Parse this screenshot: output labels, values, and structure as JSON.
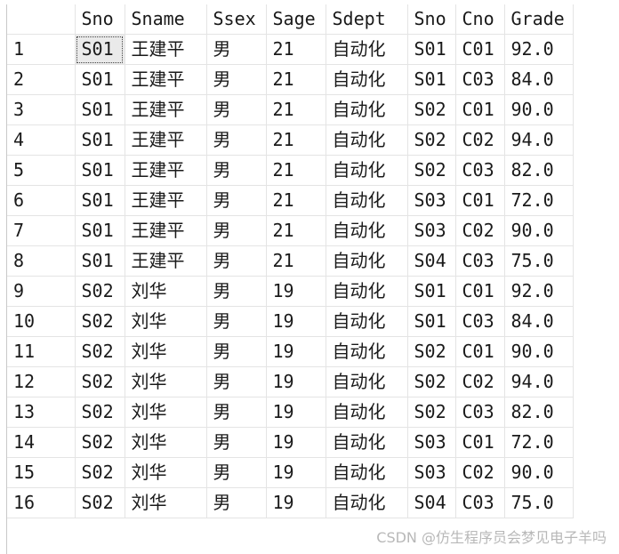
{
  "columns": [
    "Sno",
    "Sname",
    "Ssex",
    "Sage",
    "Sdept",
    "Sno",
    "Cno",
    "Grade"
  ],
  "rows": [
    {
      "num": "1",
      "cells": [
        "S01",
        "王建平",
        "男",
        "21",
        "自动化",
        "S01",
        "C01",
        "92.0"
      ]
    },
    {
      "num": "2",
      "cells": [
        "S01",
        "王建平",
        "男",
        "21",
        "自动化",
        "S01",
        "C03",
        "84.0"
      ]
    },
    {
      "num": "3",
      "cells": [
        "S01",
        "王建平",
        "男",
        "21",
        "自动化",
        "S02",
        "C01",
        "90.0"
      ]
    },
    {
      "num": "4",
      "cells": [
        "S01",
        "王建平",
        "男",
        "21",
        "自动化",
        "S02",
        "C02",
        "94.0"
      ]
    },
    {
      "num": "5",
      "cells": [
        "S01",
        "王建平",
        "男",
        "21",
        "自动化",
        "S02",
        "C03",
        "82.0"
      ]
    },
    {
      "num": "6",
      "cells": [
        "S01",
        "王建平",
        "男",
        "21",
        "自动化",
        "S03",
        "C01",
        "72.0"
      ]
    },
    {
      "num": "7",
      "cells": [
        "S01",
        "王建平",
        "男",
        "21",
        "自动化",
        "S03",
        "C02",
        "90.0"
      ]
    },
    {
      "num": "8",
      "cells": [
        "S01",
        "王建平",
        "男",
        "21",
        "自动化",
        "S04",
        "C03",
        "75.0"
      ]
    },
    {
      "num": "9",
      "cells": [
        "S02",
        "刘华",
        "男",
        "19",
        "自动化",
        "S01",
        "C01",
        "92.0"
      ]
    },
    {
      "num": "10",
      "cells": [
        "S02",
        "刘华",
        "男",
        "19",
        "自动化",
        "S01",
        "C03",
        "84.0"
      ]
    },
    {
      "num": "11",
      "cells": [
        "S02",
        "刘华",
        "男",
        "19",
        "自动化",
        "S02",
        "C01",
        "90.0"
      ]
    },
    {
      "num": "12",
      "cells": [
        "S02",
        "刘华",
        "男",
        "19",
        "自动化",
        "S02",
        "C02",
        "94.0"
      ]
    },
    {
      "num": "13",
      "cells": [
        "S02",
        "刘华",
        "男",
        "19",
        "自动化",
        "S02",
        "C03",
        "82.0"
      ]
    },
    {
      "num": "14",
      "cells": [
        "S02",
        "刘华",
        "男",
        "19",
        "自动化",
        "S03",
        "C01",
        "72.0"
      ]
    },
    {
      "num": "15",
      "cells": [
        "S02",
        "刘华",
        "男",
        "19",
        "自动化",
        "S03",
        "C02",
        "90.0"
      ]
    },
    {
      "num": "16",
      "cells": [
        "S02",
        "刘华",
        "男",
        "19",
        "自动化",
        "S04",
        "C03",
        "75.0"
      ]
    }
  ],
  "selected_cell": {
    "row": 0,
    "col": 0
  },
  "colors": {
    "grid_line": "#e4e4e4",
    "selected_bg": "#eaeaea",
    "watermark": "#b8b8b8"
  },
  "watermark": "CSDN @仿生程序员会梦见电子羊吗"
}
